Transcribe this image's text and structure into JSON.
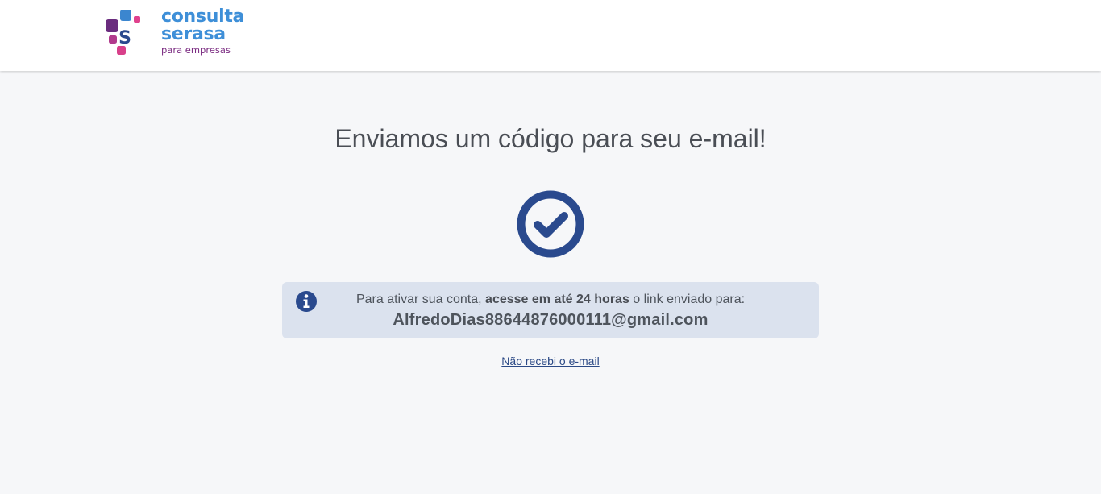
{
  "header": {
    "logo": {
      "word1": "consulta",
      "word2": "serasa",
      "word3": "para empresas",
      "mark_letter": "S"
    }
  },
  "main": {
    "title": "Enviamos um código para seu e-mail!",
    "info": {
      "text_before": "Para ativar sua conta, ",
      "text_bold": "acesse em até 24 horas",
      "text_after": " o link enviado para:",
      "email": "AlfredoDias88644876000111@gmail.com"
    },
    "resend_link": "Não recebi o e-mail"
  },
  "colors": {
    "background": "#f6f7f9",
    "brand_blue": "#3e8fd8",
    "brand_purple": "#7a2a80",
    "brand_magenta": "#d03e87",
    "icon_navy": "#2a4a8e",
    "info_bg": "#dbe2ee",
    "link": "#2c4a86"
  },
  "icons": [
    "serasa-logo-mark",
    "check-circle-icon",
    "info-icon"
  ]
}
